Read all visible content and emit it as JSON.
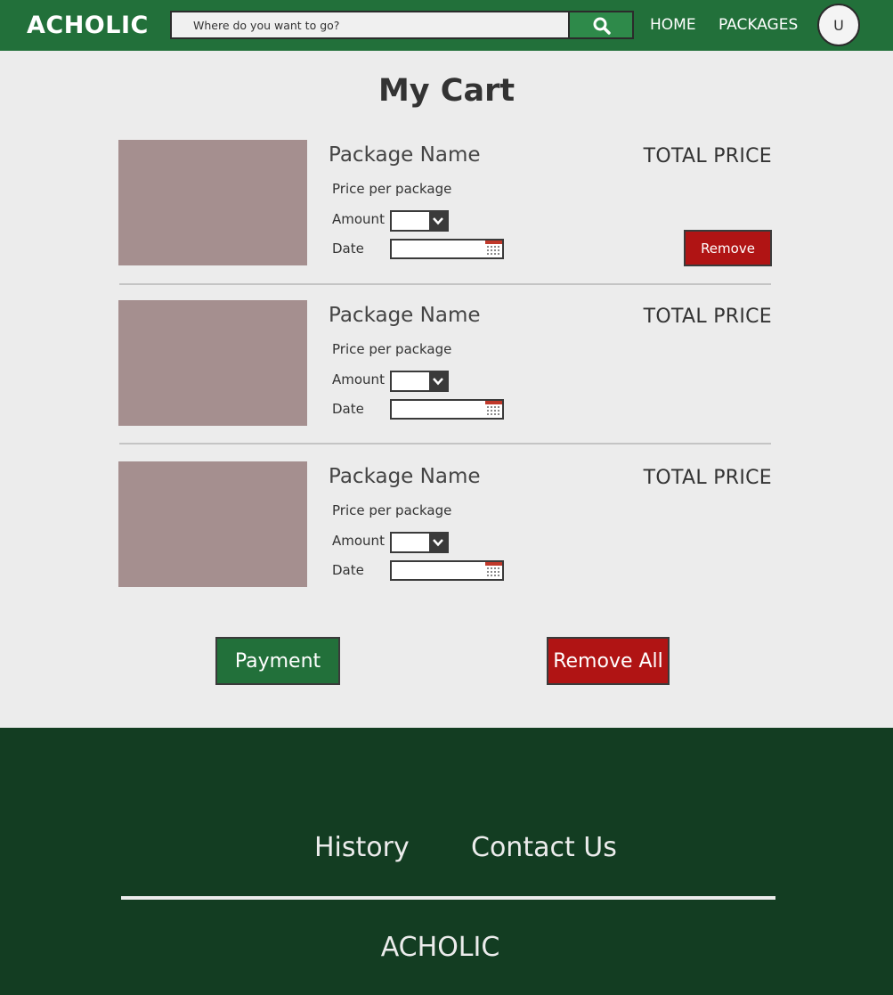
{
  "header": {
    "brand": "ACHOLIC",
    "search": {
      "placeholder": "Where do you want to go?",
      "value": ""
    },
    "nav": {
      "home": "HOME",
      "packages": "PACKAGES"
    },
    "avatar_initial": "U"
  },
  "main": {
    "title": "My Cart",
    "items": [
      {
        "name": "Package Name",
        "price_per_label": "Price per package",
        "amount_label": "Amount",
        "amount_value": "",
        "date_label": "Date",
        "date_value": "",
        "total_label": "TOTAL PRICE",
        "remove_label": "Remove"
      },
      {
        "name": "Package Name",
        "price_per_label": "Price per package",
        "amount_label": "Amount",
        "amount_value": "",
        "date_label": "Date",
        "date_value": "",
        "total_label": "TOTAL PRICE"
      },
      {
        "name": "Package Name",
        "price_per_label": "Price per package",
        "amount_label": "Amount",
        "amount_value": "",
        "date_label": "Date",
        "date_value": "",
        "total_label": "TOTAL PRICE"
      }
    ],
    "payment_label": "Payment",
    "remove_all_label": "Remove All"
  },
  "footer": {
    "history": "History",
    "contact": "Contact Us",
    "brand": "ACHOLIC"
  },
  "icons": {
    "search": "search-icon",
    "dropdown": "chevron-down-icon",
    "calendar": "calendar-icon"
  },
  "colors": {
    "primary_green": "#22703a",
    "footer_green": "#133d22",
    "danger_red": "#b01414",
    "background": "#ececec",
    "placeholder_image": "#a58f8f"
  }
}
